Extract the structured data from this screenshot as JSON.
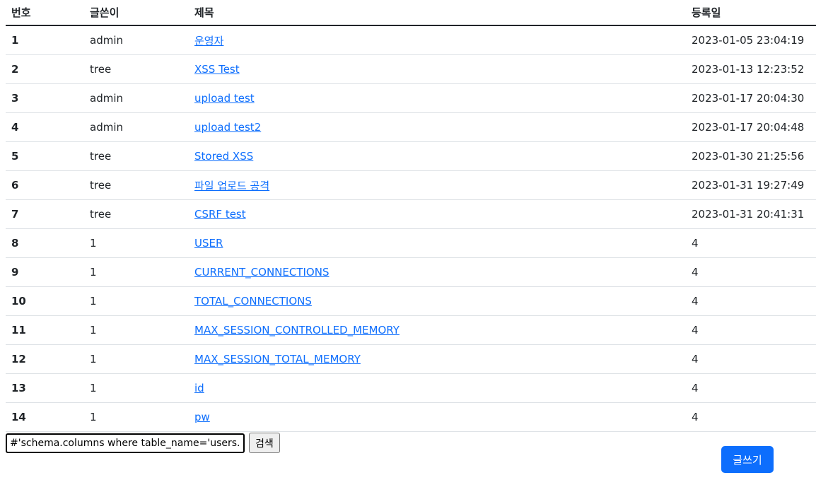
{
  "table": {
    "headers": [
      "번호",
      "글쓴이",
      "제목",
      "등록일"
    ],
    "rows": [
      {
        "no": "1",
        "writer": "admin",
        "title": "운영자",
        "date": "2023-01-05 23:04:19"
      },
      {
        "no": "2",
        "writer": "tree",
        "title": "XSS Test",
        "date": "2023-01-13 12:23:52"
      },
      {
        "no": "3",
        "writer": "admin",
        "title": "upload test",
        "date": "2023-01-17 20:04:30"
      },
      {
        "no": "4",
        "writer": "admin",
        "title": "upload test2",
        "date": "2023-01-17 20:04:48"
      },
      {
        "no": "5",
        "writer": "tree",
        "title": "Stored XSS",
        "date": "2023-01-30 21:25:56"
      },
      {
        "no": "6",
        "writer": "tree",
        "title": "파일 업로드 공격",
        "date": "2023-01-31 19:27:49"
      },
      {
        "no": "7",
        "writer": "tree",
        "title": "CSRF test",
        "date": "2023-01-31 20:41:31"
      },
      {
        "no": "8",
        "writer": "1",
        "title": "USER",
        "date": "4"
      },
      {
        "no": "9",
        "writer": "1",
        "title": "CURRENT_CONNECTIONS",
        "date": "4"
      },
      {
        "no": "10",
        "writer": "1",
        "title": "TOTAL_CONNECTIONS",
        "date": "4"
      },
      {
        "no": "11",
        "writer": "1",
        "title": "MAX_SESSION_CONTROLLED_MEMORY",
        "date": "4"
      },
      {
        "no": "12",
        "writer": "1",
        "title": "MAX_SESSION_TOTAL_MEMORY",
        "date": "4"
      },
      {
        "no": "13",
        "writer": "1",
        "title": "id",
        "date": "4"
      },
      {
        "no": "14",
        "writer": "1",
        "title": "pw",
        "date": "4"
      }
    ]
  },
  "search": {
    "value": ".schema.columns where table_name='users'#",
    "button_label": "검색"
  },
  "write_button_label": "글쓰기",
  "colors": {
    "link": "#0d6efd",
    "primary_button": "#0d6efd"
  }
}
